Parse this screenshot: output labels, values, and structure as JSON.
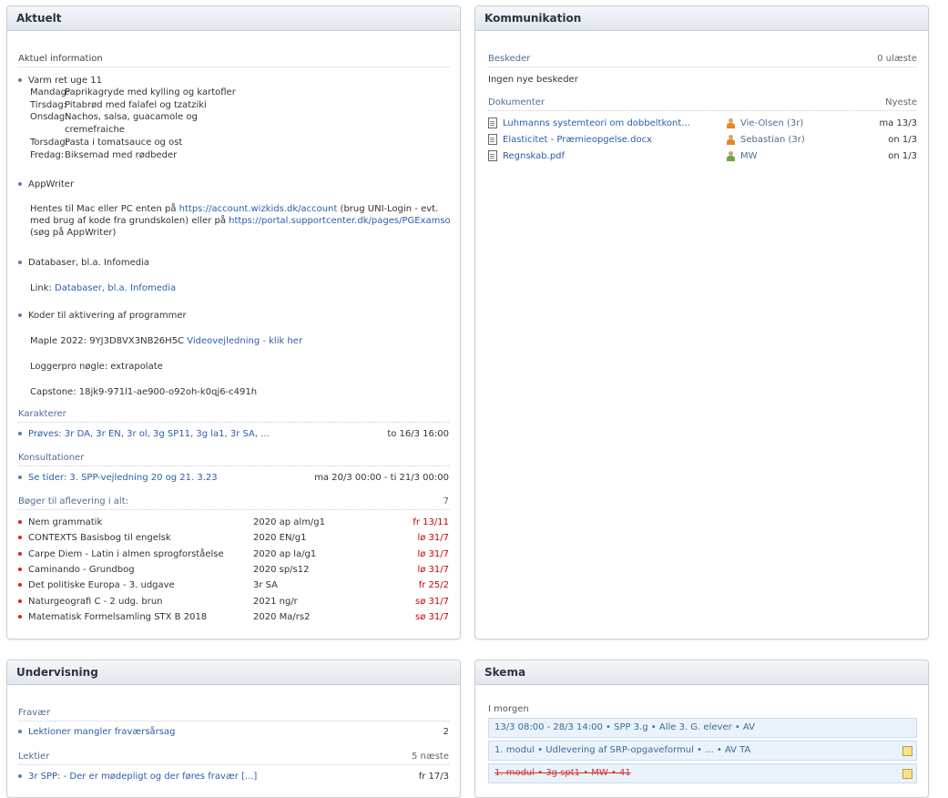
{
  "aktuelt": {
    "title": "Aktuelt",
    "info_header": "Aktuel information",
    "menu": {
      "title": "Varm ret uge 11",
      "days": [
        {
          "day": "Mandag:",
          "dish": "Paprikagryde med kylling og kartofler"
        },
        {
          "day": "Tirsdag:",
          "dish": "Pitabrød med falafel og tzatziki"
        },
        {
          "day": "Onsdag:",
          "dish": "Nachos, salsa, guacamole og"
        },
        {
          "day": "",
          "dish": "cremefraiche"
        },
        {
          "day": "Torsdag:",
          "dish": "Pasta i tomatsauce og ost"
        },
        {
          "day": "Fredag:",
          "dish": "Biksemad med rødbeder"
        }
      ]
    },
    "appwriter": {
      "title": "AppWriter",
      "line1_pre": "Hentes til Mac eller PC enten på ",
      "line1_link": "https://account.wizkids.dk/account",
      "line1_post": " (brug UNI-Login - evt.",
      "line2_pre": "med brug af kode fra grundskolen) eller på ",
      "line2_link": "https://portal.supportcenter.dk/pages/PGExamso",
      "line3": "(søg på AppWriter)"
    },
    "databaser": {
      "title": "Databaser, bl.a. Infomedia",
      "link_label": "Link:",
      "link_text": "Databaser, bl.a. Infomedia"
    },
    "koder": {
      "title": "Koder til aktivering af programmer",
      "maple_pre": "Maple 2022: 9YJ3D8VX3NB26H5C ",
      "maple_link": "Videovejledning - klik her",
      "loggerpro": "Loggerpro nøgle: extrapolate",
      "capstone": "Capstone: 18jk9-971l1-ae900-o92oh-k0qj6-c491h"
    },
    "karakterer": {
      "title": "Karakterer",
      "item": "Prøves: 3r DA, 3r EN, 3r ol, 3g SP11, 3g la1, 3r SA, ...",
      "date": "to 16/3 16:00"
    },
    "konsultationer": {
      "title": "Konsultationer",
      "item": "Se tider: 3. SPP-vejledning 20 og 21. 3.23",
      "date": "ma 20/3 00:00 - ti 21/3 00:00"
    },
    "boger": {
      "title": "Bøger til aflevering i alt:",
      "count": "7",
      "items": [
        {
          "title": "Nem grammatik",
          "code": "2020 ap alm/g1",
          "date": "fr 13/11"
        },
        {
          "title": "CONTEXTS Basisbog til engelsk",
          "code": "2020 EN/g1",
          "date": "lø 31/7"
        },
        {
          "title": "Carpe Diem - Latin i almen sprogforståelse",
          "code": "2020 ap la/g1",
          "date": "lø 31/7"
        },
        {
          "title": "Caminando - Grundbog",
          "code": "2020 sp/s12",
          "date": "lø 31/7"
        },
        {
          "title": "Det politiske Europa - 3. udgave",
          "code": "3r SA",
          "date": "fr 25/2"
        },
        {
          "title": "Naturgeografi C - 2 udg. brun",
          "code": "2021 ng/r",
          "date": "sø 31/7"
        },
        {
          "title": "Matematisk Formelsamling STX B 2018",
          "code": "2020 Ma/rs2",
          "date": "sø 31/7"
        }
      ]
    }
  },
  "kommunikation": {
    "title": "Kommunikation",
    "beskeder_title": "Beskeder",
    "beskeder_right": "0 ulæste",
    "beskeder_empty": "Ingen nye beskeder",
    "dokumenter_title": "Dokumenter",
    "dokumenter_right": "Nyeste",
    "documents": [
      {
        "name": "Luhmanns systemteori om dobbeltkont...",
        "author": "Vie-Olsen (3r)",
        "date": "ma 13/3",
        "icon_color": "orange"
      },
      {
        "name": "Elasticitet - Præmieopgelse.docx",
        "author": "Sebastian (3r)",
        "date": "on 1/3",
        "icon_color": "orange"
      },
      {
        "name": "Regnskab.pdf",
        "author": "MW",
        "date": "on 1/3",
        "icon_color": "green"
      }
    ]
  },
  "undervisning": {
    "title": "Undervisning",
    "fravaer_title": "Fravær",
    "fravaer_item": "Lektioner mangler fraværsårsag",
    "fravaer_count": "2",
    "lektier_title": "Lektier",
    "lektier_right": "5 næste",
    "lektier_item": "3r SPP: - Der er mødepligt og der føres fravær [...]",
    "lektier_date": "fr 17/3"
  },
  "skema": {
    "title": "Skema",
    "day_title": "I morgen",
    "events": [
      {
        "text": "13/3 08:00 - 28/3 14:00 • SPP 3.g • Alle 3. G. elever • AV",
        "note": false,
        "strike": false
      },
      {
        "text": "1. modul • Udlevering af SRP-opgaveformul • ... • AV TA",
        "note": true,
        "strike": false
      },
      {
        "text": "1. modul • 3g spt1 • MW • 41",
        "note": true,
        "strike": true
      }
    ]
  }
}
